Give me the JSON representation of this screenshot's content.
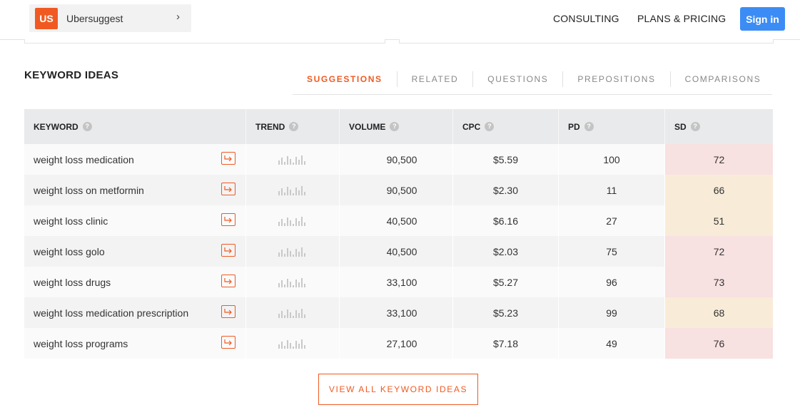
{
  "header": {
    "brand_badge": "US",
    "brand_name": "Ubersuggest",
    "nav": [
      "CONSULTING",
      "PLANS & PRICING"
    ],
    "signin_label": "Sign in"
  },
  "section": {
    "title": "KEYWORD IDEAS",
    "tabs": [
      "SUGGESTIONS",
      "RELATED",
      "QUESTIONS",
      "PREPOSITIONS",
      "COMPARISONS"
    ],
    "active_tab": "SUGGESTIONS"
  },
  "table": {
    "columns": [
      "KEYWORD",
      "TREND",
      "VOLUME",
      "CPC",
      "PD",
      "SD"
    ],
    "help_glyph": "?",
    "rows": [
      {
        "keyword": "weight loss medication",
        "volume": "90,500",
        "cpc": "$5.59",
        "pd": "100",
        "sd": "72",
        "sd_level": "red"
      },
      {
        "keyword": "weight loss on metformin",
        "volume": "90,500",
        "cpc": "$2.30",
        "pd": "11",
        "sd": "66",
        "sd_level": "amber"
      },
      {
        "keyword": "weight loss clinic",
        "volume": "40,500",
        "cpc": "$6.16",
        "pd": "27",
        "sd": "51",
        "sd_level": "amber"
      },
      {
        "keyword": "weight loss golo",
        "volume": "40,500",
        "cpc": "$2.03",
        "pd": "75",
        "sd": "72",
        "sd_level": "red"
      },
      {
        "keyword": "weight loss drugs",
        "volume": "33,100",
        "cpc": "$5.27",
        "pd": "96",
        "sd": "73",
        "sd_level": "red"
      },
      {
        "keyword": "weight loss medication prescription",
        "volume": "33,100",
        "cpc": "$5.23",
        "pd": "99",
        "sd": "68",
        "sd_level": "amber"
      },
      {
        "keyword": "weight loss programs",
        "volume": "27,100",
        "cpc": "$7.18",
        "pd": "49",
        "sd": "76",
        "sd_level": "red"
      }
    ]
  },
  "view_all_label": "VIEW ALL KEYWORD IDEAS",
  "colors": {
    "accent": "#f05a22",
    "signin": "#3c8cf5",
    "sd_red": "#f8e1e1",
    "sd_amber": "#f8ecd8"
  },
  "icons": {
    "brand_chevron": "chevron-right-icon",
    "row_action": "arrow-corner-icon",
    "help": "help-icon",
    "trend": "trend-sparkline-icon"
  }
}
